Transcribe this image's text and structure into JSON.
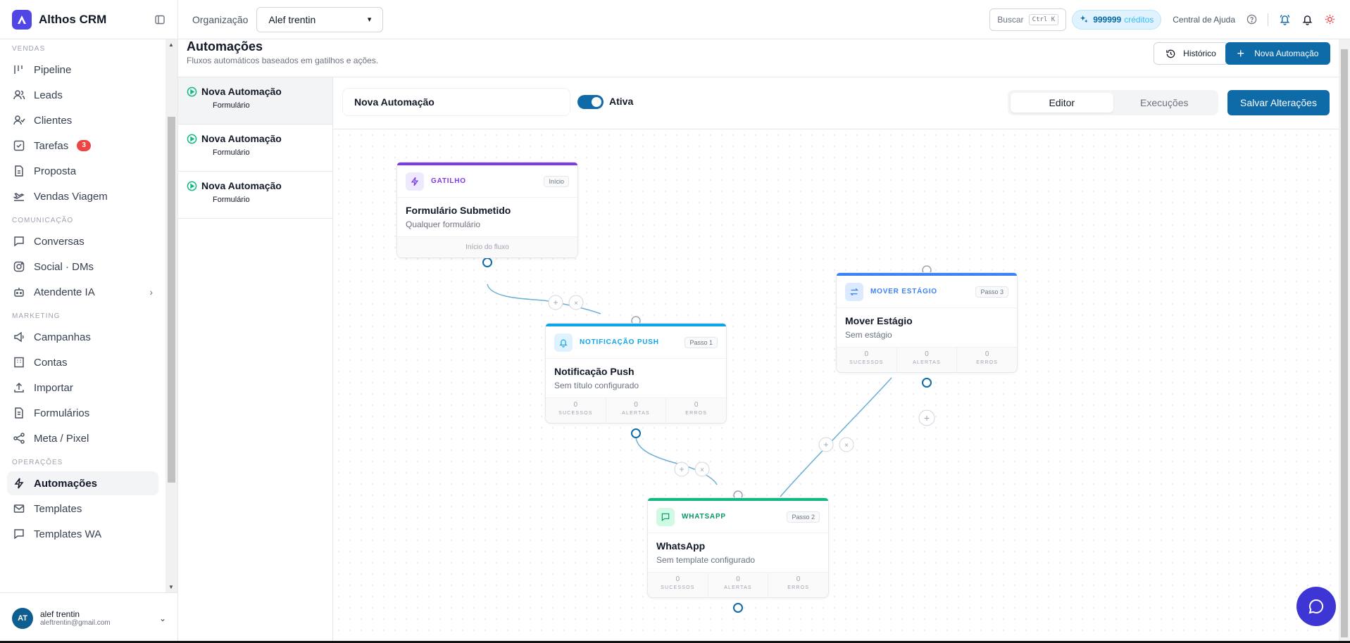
{
  "brand": {
    "name": "Althos CRM"
  },
  "topbar": {
    "org_label": "Organização",
    "org_value": "Alef trentin",
    "search_label": "Buscar",
    "search_kbd": "Ctrl K",
    "credits_value": "999999",
    "credits_label": "créditos",
    "help_label": "Central de Ajuda"
  },
  "sidebar": {
    "sections": {
      "vendas": "VENDAS",
      "comunicacao": "COMUNICAÇÃO",
      "marketing": "MARKETING",
      "operacoes": "OPERAÇÕES"
    },
    "items": {
      "pipeline": "Pipeline",
      "leads": "Leads",
      "clientes": "Clientes",
      "tarefas": "Tarefas",
      "tarefas_badge": "3",
      "proposta": "Proposta",
      "vendas_viagem": "Vendas Viagem",
      "conversas": "Conversas",
      "social": "Social · DMs",
      "atendente": "Atendente IA",
      "campanhas": "Campanhas",
      "contas": "Contas",
      "importar": "Importar",
      "formularios": "Formulários",
      "meta": "Meta / Pixel",
      "automacoes": "Automações",
      "templates": "Templates",
      "templates_wa": "Templates WA"
    },
    "user": {
      "initials": "AT",
      "name": "alef trentin",
      "email": "aleftrentin@gmail.com"
    }
  },
  "page": {
    "title": "Automações",
    "subtitle": "Fluxos automáticos baseados em gatilhos e ações.",
    "history_label": "Histórico",
    "new_label": "Nova Automação"
  },
  "automations": [
    {
      "name": "Nova Automação",
      "tag": "Formulário"
    },
    {
      "name": "Nova Automação",
      "tag": "Formulário"
    },
    {
      "name": "Nova Automação",
      "tag": "Formulário"
    }
  ],
  "editor": {
    "name_value": "Nova Automação",
    "toggle_label": "Ativa",
    "tab_editor": "Editor",
    "tab_exec": "Execuções",
    "save_label": "Salvar Alterações"
  },
  "nodes": {
    "trigger": {
      "type": "GATILHO",
      "step": "Início",
      "title": "Formulário Submetido",
      "desc": "Qualquer formulário",
      "foot": "Início do fluxo"
    },
    "push": {
      "type": "NOTIFICAÇÃO PUSH",
      "step": "Passo 1",
      "title": "Notificação Push",
      "desc": "Sem título configurado"
    },
    "whatsapp": {
      "type": "WHATSAPP",
      "step": "Passo 2",
      "title": "WhatsApp",
      "desc": "Sem template configurado"
    },
    "move": {
      "type": "MOVER ESTÁGIO",
      "step": "Passo 3",
      "title": "Mover Estágio",
      "desc": "Sem estágio"
    }
  },
  "stats": {
    "success": "SUCESSOS",
    "alerts": "ALERTAS",
    "errors": "ERROS",
    "zero": "0"
  },
  "colors": {
    "accent": "#0e6ba8",
    "trigger": "#7c3aed",
    "push": "#0ea5e9",
    "whatsapp": "#10b981",
    "move": "#3b82f6"
  }
}
